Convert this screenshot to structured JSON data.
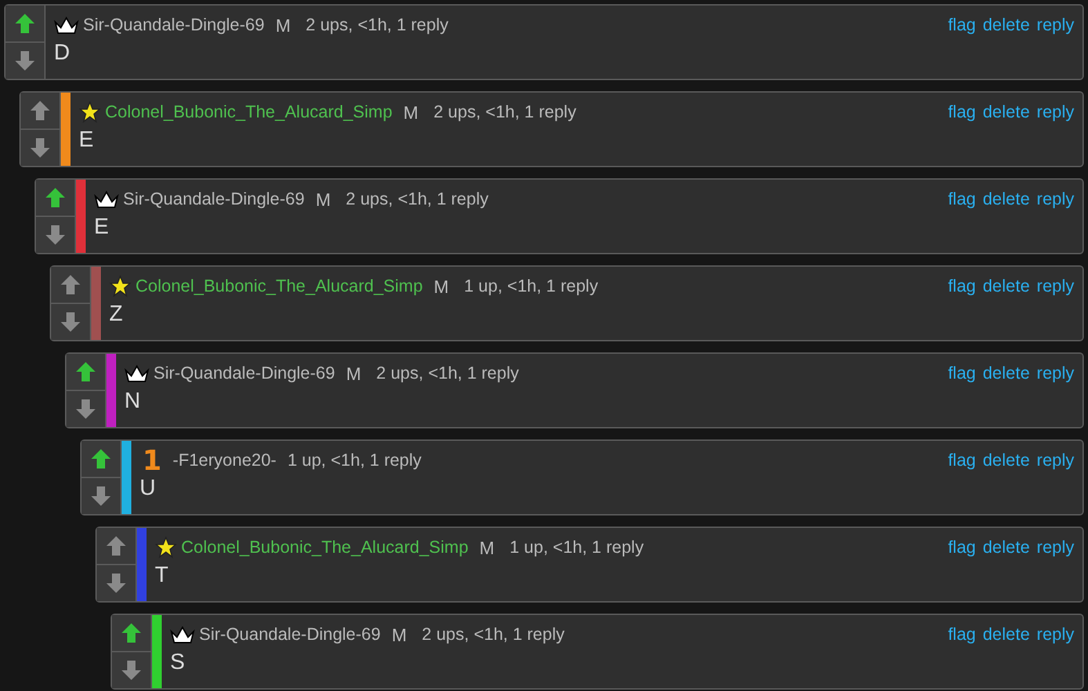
{
  "comments": [
    {
      "badge": {
        "kind": "crown"
      },
      "user": "Sir-Quandale-Dingle-69",
      "highlighted": false,
      "mod": "M",
      "meta": "2 ups, <1h, 1 reply",
      "upvoted": true,
      "actions": [
        "flag",
        "delete",
        "reply"
      ],
      "text": "D",
      "children": [
        {
          "badge": {
            "kind": "star"
          },
          "user": "Colonel_Bubonic_The_Alucard_Simp",
          "highlighted": true,
          "mod": "M",
          "meta": "2 ups, <1h, 1 reply",
          "upvoted": false,
          "color": "#f08a1c",
          "actions": [
            "flag",
            "delete",
            "reply"
          ],
          "text": "E",
          "children": [
            {
              "badge": {
                "kind": "crown"
              },
              "user": "Sir-Quandale-Dingle-69",
              "highlighted": false,
              "mod": "M",
              "meta": "2 ups, <1h, 1 reply",
              "upvoted": true,
              "color": "#e0303a",
              "actions": [
                "flag",
                "delete",
                "reply"
              ],
              "text": "E",
              "children": [
                {
                  "badge": {
                    "kind": "star"
                  },
                  "user": "Colonel_Bubonic_The_Alucard_Simp",
                  "highlighted": true,
                  "mod": "M",
                  "meta": "1 up, <1h, 1 reply",
                  "upvoted": false,
                  "color": "#a05050",
                  "actions": [
                    "flag",
                    "delete",
                    "reply"
                  ],
                  "text": "Z",
                  "children": [
                    {
                      "badge": {
                        "kind": "crown"
                      },
                      "user": "Sir-Quandale-Dingle-69",
                      "highlighted": false,
                      "mod": "M",
                      "meta": "2 ups, <1h, 1 reply",
                      "upvoted": true,
                      "color": "#c020c0",
                      "actions": [
                        "flag",
                        "delete",
                        "reply"
                      ],
                      "text": "N",
                      "children": [
                        {
                          "badge": {
                            "kind": "rank",
                            "text": "1"
                          },
                          "user": "-F1eryone20-",
                          "highlighted": false,
                          "meta": "1 up, <1h, 1 reply",
                          "upvoted": true,
                          "color": "#20b0e0",
                          "actions": [
                            "flag",
                            "delete",
                            "reply"
                          ],
                          "text": "U",
                          "children": [
                            {
                              "badge": {
                                "kind": "star"
                              },
                              "user": "Colonel_Bubonic_The_Alucard_Simp",
                              "highlighted": true,
                              "mod": "M",
                              "meta": "1 up, <1h, 1 reply",
                              "upvoted": false,
                              "color": "#3040e0",
                              "actions": [
                                "flag",
                                "delete",
                                "reply"
                              ],
                              "text": "T",
                              "children": [
                                {
                                  "badge": {
                                    "kind": "crown"
                                  },
                                  "user": "Sir-Quandale-Dingle-69",
                                  "highlighted": false,
                                  "mod": "M",
                                  "meta": "2 ups, <1h, 1 reply",
                                  "upvoted": true,
                                  "color": "#30d030",
                                  "actions": [
                                    "flag",
                                    "delete",
                                    "reply"
                                  ],
                                  "text": "S"
                                }
                              ]
                            }
                          ]
                        }
                      ]
                    }
                  ]
                }
              ]
            }
          ]
        }
      ]
    }
  ]
}
